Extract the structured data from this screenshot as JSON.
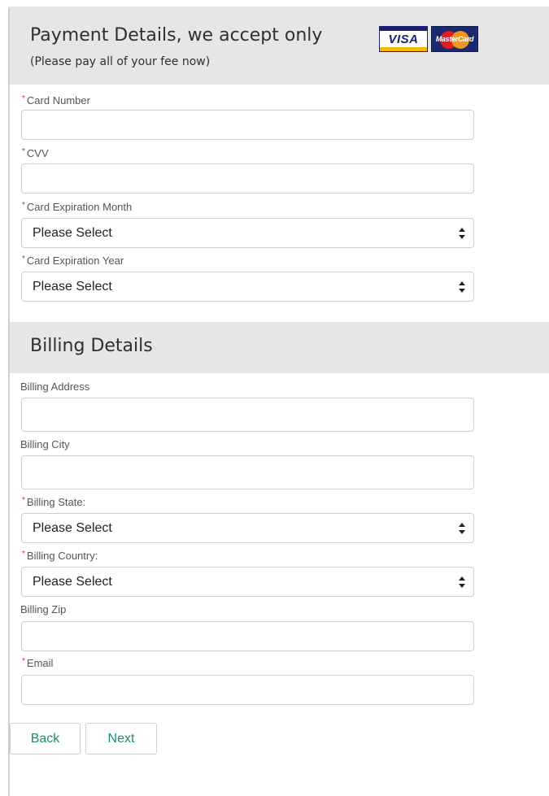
{
  "payment": {
    "title": "Payment Details, we accept only",
    "subtitle": "(Please pay all of your fee now)",
    "logos": {
      "visa": "VISA",
      "mastercard": "MasterCard"
    },
    "fields": {
      "card_number": {
        "label": "Card Number",
        "required": true,
        "value": ""
      },
      "cvv": {
        "label": "CVV",
        "required": true,
        "value": ""
      },
      "exp_month": {
        "label": "Card Expiration Month",
        "required": true,
        "selected": "Please Select"
      },
      "exp_year": {
        "label": "Card Expiration Year",
        "required": true,
        "selected": "Please Select"
      }
    }
  },
  "billing": {
    "title": "Billing Details",
    "fields": {
      "address": {
        "label": "Billing Address",
        "required": false,
        "value": ""
      },
      "city": {
        "label": "Billing City",
        "required": false,
        "value": ""
      },
      "state": {
        "label": "Billing State:",
        "required": true,
        "selected": "Please Select"
      },
      "country": {
        "label": "Billing Country:",
        "required": true,
        "selected": "Please Select"
      },
      "zip": {
        "label": "Billing Zip",
        "required": false,
        "value": ""
      },
      "email": {
        "label": "Email",
        "required": true,
        "value": ""
      }
    }
  },
  "actions": {
    "back": "Back",
    "next": "Next"
  },
  "required_marker": "*",
  "colors": {
    "accent": "#1e8a74",
    "required": "#c0392b",
    "panel": "#e6e6e6"
  }
}
